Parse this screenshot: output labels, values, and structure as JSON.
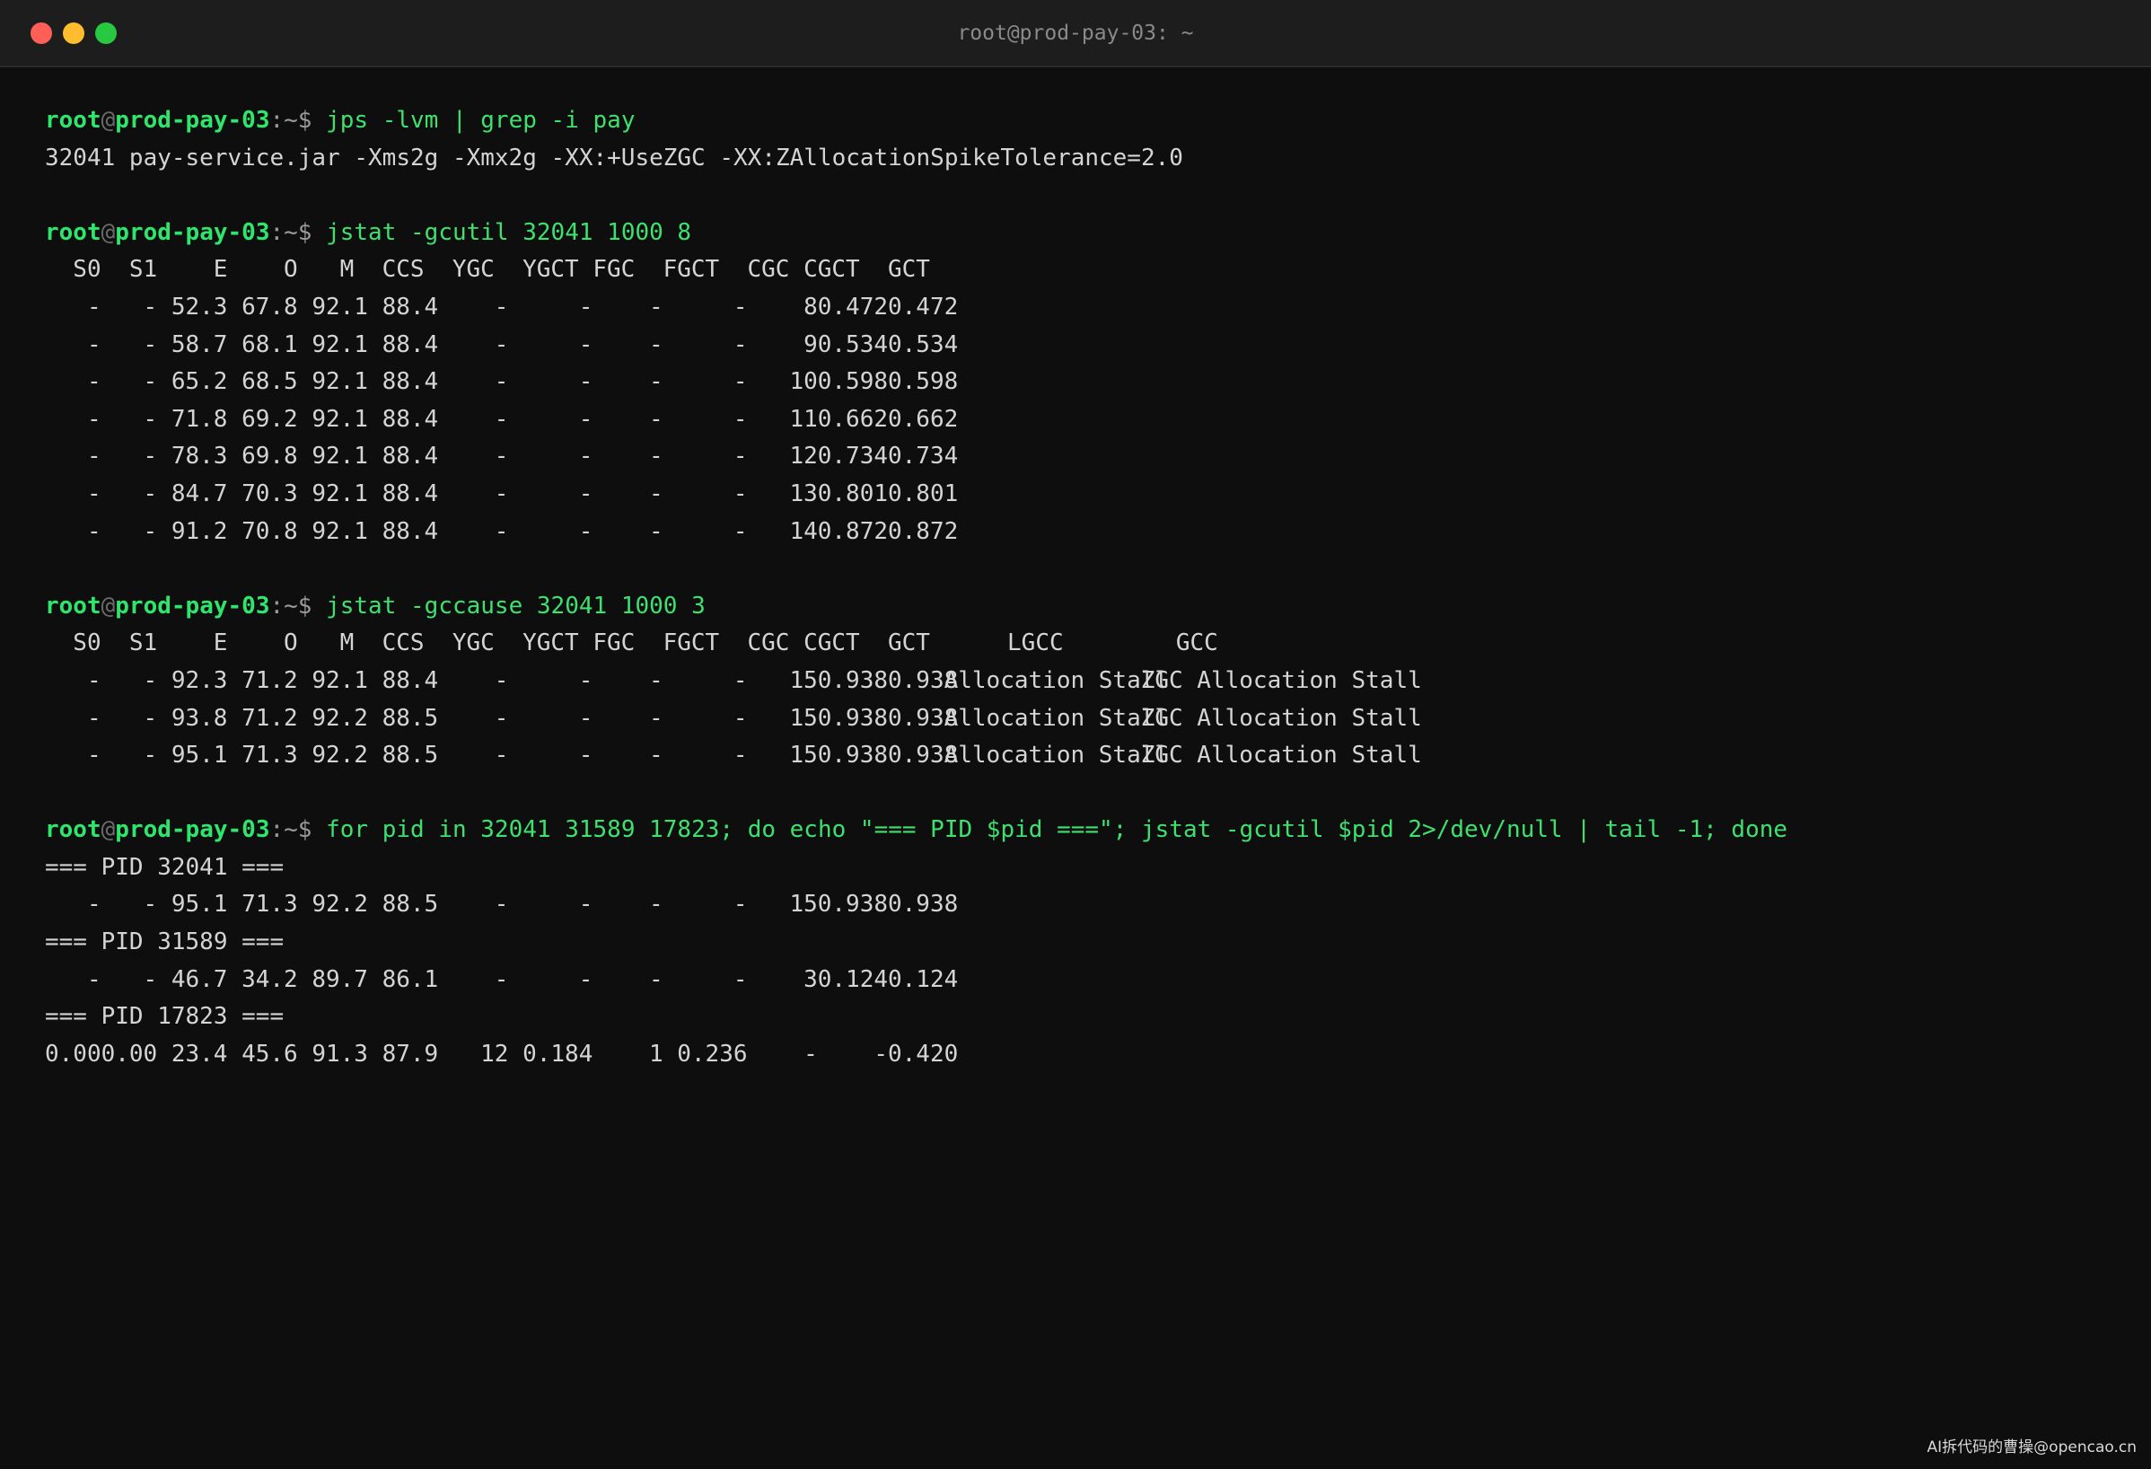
{
  "window": {
    "title": "root@prod-pay-03: ~",
    "colors": {
      "close": "#ff5f57",
      "minimize": "#febc2e",
      "zoom": "#28c840",
      "prompt": "#2ee66b",
      "command": "#3ee06e"
    }
  },
  "prompt": {
    "user": "root",
    "at": "@",
    "host": "prod-pay-03",
    "path": ":~$ "
  },
  "blocks": [
    {
      "command": "jps -lvm | grep -i pay",
      "output": [
        "32041 pay-service.jar -Xms2g -Xmx2g -XX:+UseZGC -XX:ZAllocationSpikeTolerance=2.0"
      ]
    },
    {
      "command": "jstat -gcutil 32041 1000 8",
      "header": [
        "S0",
        "S1",
        "E",
        "O",
        "M",
        "CCS",
        "YGC",
        "YGCT",
        "FGC",
        "FGCT",
        "CGC",
        "CGCT",
        "GCT"
      ],
      "rows": [
        [
          "-",
          "-",
          "52.3",
          "67.8",
          "92.1",
          "88.4",
          "-",
          "-",
          "-",
          "-",
          "8",
          "0.472",
          "0.472"
        ],
        [
          "-",
          "-",
          "58.7",
          "68.1",
          "92.1",
          "88.4",
          "-",
          "-",
          "-",
          "-",
          "9",
          "0.534",
          "0.534"
        ],
        [
          "-",
          "-",
          "65.2",
          "68.5",
          "92.1",
          "88.4",
          "-",
          "-",
          "-",
          "-",
          "10",
          "0.598",
          "0.598"
        ],
        [
          "-",
          "-",
          "71.8",
          "69.2",
          "92.1",
          "88.4",
          "-",
          "-",
          "-",
          "-",
          "11",
          "0.662",
          "0.662"
        ],
        [
          "-",
          "-",
          "78.3",
          "69.8",
          "92.1",
          "88.4",
          "-",
          "-",
          "-",
          "-",
          "12",
          "0.734",
          "0.734"
        ],
        [
          "-",
          "-",
          "84.7",
          "70.3",
          "92.1",
          "88.4",
          "-",
          "-",
          "-",
          "-",
          "13",
          "0.801",
          "0.801"
        ],
        [
          "-",
          "-",
          "91.2",
          "70.8",
          "92.1",
          "88.4",
          "-",
          "-",
          "-",
          "-",
          "14",
          "0.872",
          "0.872"
        ]
      ]
    },
    {
      "command": "jstat -gccause 32041 1000 3",
      "header": [
        "S0",
        "S1",
        "E",
        "O",
        "M",
        "CCS",
        "YGC",
        "YGCT",
        "FGC",
        "FGCT",
        "CGC",
        "CGCT",
        "GCT",
        "LGCC",
        "GCC"
      ],
      "rows": [
        [
          "-",
          "-",
          "92.3",
          "71.2",
          "92.1",
          "88.4",
          "-",
          "-",
          "-",
          "-",
          "15",
          "0.938",
          "0.938",
          "Allocation Stall",
          "ZGC Allocation Stall"
        ],
        [
          "-",
          "-",
          "93.8",
          "71.2",
          "92.2",
          "88.5",
          "-",
          "-",
          "-",
          "-",
          "15",
          "0.938",
          "0.938",
          "Allocation Stall",
          "ZGC Allocation Stall"
        ],
        [
          "-",
          "-",
          "95.1",
          "71.3",
          "92.2",
          "88.5",
          "-",
          "-",
          "-",
          "-",
          "15",
          "0.938",
          "0.938",
          "Allocation Stall",
          "ZGC Allocation Stall"
        ]
      ]
    },
    {
      "command": "for pid in 32041 31589 17823; do echo \"=== PID $pid ===\"; jstat -gcutil $pid 2>/dev/null | tail -1; done",
      "pids": [
        {
          "label": "=== PID 32041 ===",
          "row": [
            "-",
            "-",
            "95.1",
            "71.3",
            "92.2",
            "88.5",
            "-",
            "-",
            "-",
            "-",
            "15",
            "0.938",
            "0.938"
          ]
        },
        {
          "label": "=== PID 31589 ===",
          "row": [
            "-",
            "-",
            "46.7",
            "34.2",
            "89.7",
            "86.1",
            "-",
            "-",
            "-",
            "-",
            "3",
            "0.124",
            "0.124"
          ]
        },
        {
          "label": "=== PID 17823 ===",
          "row": [
            "0.00",
            "0.00",
            "23.4",
            "45.6",
            "91.3",
            "87.9",
            "12",
            "0.184",
            "1",
            "0.236",
            "-",
            "-",
            "0.420"
          ]
        }
      ]
    }
  ],
  "watermark": "AI拆代码的曹操@opencao.cn"
}
